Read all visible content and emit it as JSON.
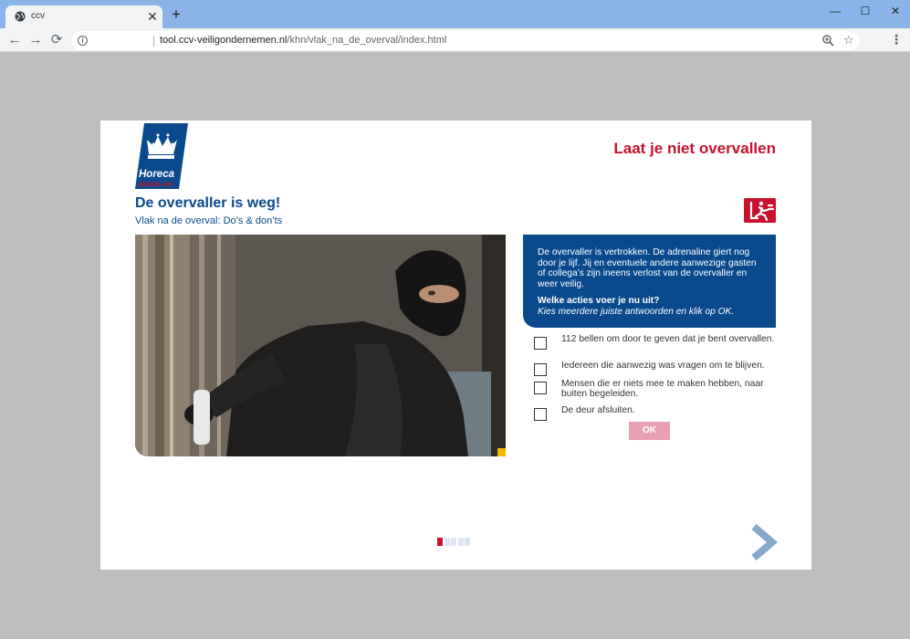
{
  "browser": {
    "tab_title": "ccv",
    "tab_close": "✕",
    "new_tab": "+",
    "url_host": "tool.ccv-veiligondernemen.nl",
    "url_path": "/khn/vlak_na_de_overval/index.html",
    "window_controls": {
      "minimize": "—",
      "maximize": "☐",
      "close": "✕"
    },
    "nav": {
      "back": "←",
      "forward": "→",
      "reload": "⟳"
    },
    "info": "i",
    "menu": "⋮",
    "star": "☆"
  },
  "header": {
    "app_title": "Laat je niet overvallen",
    "logo": {
      "brand": "Horeca",
      "sub": "NEDERLAND"
    }
  },
  "page": {
    "heading": "De overvaller is weg!",
    "subheading": "Vlak na de overval: Do’s & don’ts"
  },
  "question": {
    "intro": "De overvaller is vertrokken. De adrenaline giert nog door je lijf. Jij en eventuele andere aanwezige gasten of collega’s zijn ineens verlost van de overvaller en weer veilig.",
    "prompt": "Welke acties voer je nu uit?",
    "instruction": "Kies meerdere juiste antwoorden en klik op OK."
  },
  "answers": [
    {
      "label": "112 bellen om door te geven dat je bent overvallen.",
      "checked": false
    },
    {
      "label": "Iedereen die aanwezig was vragen om te blijven.",
      "checked": false
    },
    {
      "label": "Mensen die er niets mee te maken hebben, naar buiten begeleiden.",
      "checked": false
    },
    {
      "label": "De deur afsluiten.",
      "checked": false
    }
  ],
  "ok_label": "OK",
  "progress": {
    "current": 1,
    "total": 5
  },
  "colors": {
    "brand_red": "#c8102e",
    "brand_blue": "#0a4a8c",
    "ok_button": "#e8a0b4",
    "progress_active": "#c8102e",
    "progress_inactive": "#dde5f2",
    "next_arrow": "#8aa8cc",
    "accent_yellow": "#f2b400"
  },
  "icons": [
    "globe-icon",
    "close-icon",
    "plus-icon",
    "back-icon",
    "forward-icon",
    "reload-icon",
    "info-icon",
    "zoom-icon",
    "star-icon",
    "menu-icon",
    "emergency-exit-icon",
    "next-arrow-icon"
  ]
}
